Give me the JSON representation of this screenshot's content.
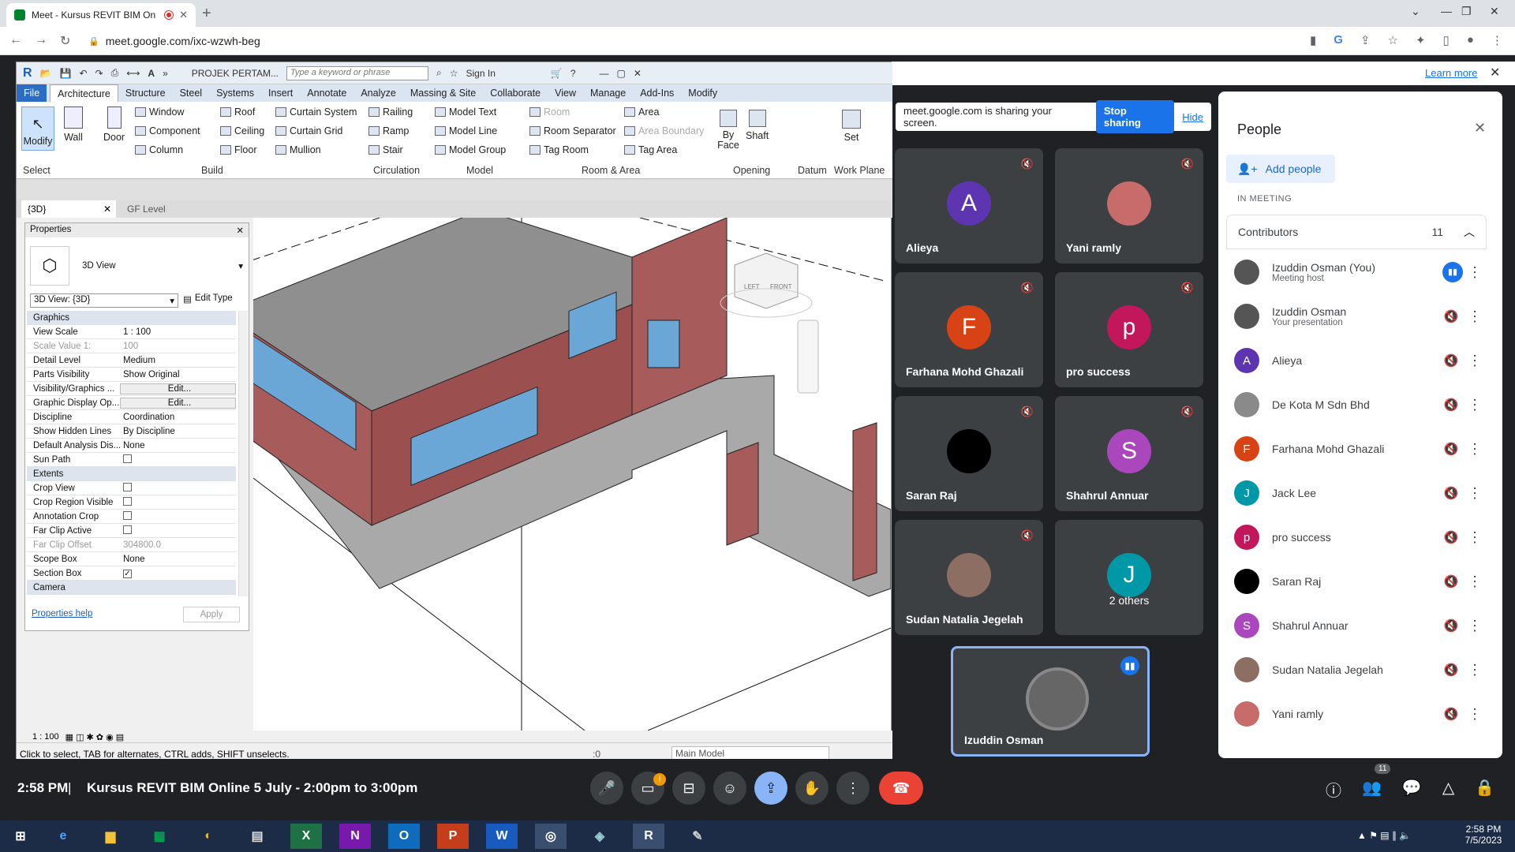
{
  "browser": {
    "tab_title": "Meet - Kursus REVIT BIM On",
    "url": "meet.google.com/ixc-wzwh-beg",
    "learn_more": "Learn more"
  },
  "revit": {
    "qat_project": "PROJEK PERTAM...",
    "search_placeholder": "Type a keyword or phrase",
    "sign_in": "Sign In",
    "tabs": [
      "File",
      "Architecture",
      "Structure",
      "Steel",
      "Systems",
      "Insert",
      "Annotate",
      "Analyze",
      "Massing & Site",
      "Collaborate",
      "View",
      "Manage",
      "Add-Ins",
      "Modify"
    ],
    "ribbon": {
      "modify": "Modify",
      "wall": "Wall",
      "door": "Door",
      "window": "Window",
      "component": "Component",
      "column": "Column",
      "roof": "Roof",
      "ceiling": "Ceiling",
      "floor": "Floor",
      "curtain_system": "Curtain System",
      "curtain_grid": "Curtain Grid",
      "mullion": "Mullion",
      "railing": "Railing",
      "ramp": "Ramp",
      "stair": "Stair",
      "model_text": "Model Text",
      "model_line": "Model Line",
      "model_group": "Model Group",
      "room": "Room",
      "room_separator": "Room Separator",
      "tag_room": "Tag Room",
      "area": "Area",
      "area_boundary": "Area Boundary",
      "tag_area": "Tag Area",
      "by_face": "By Face",
      "shaft": "Shaft",
      "set": "Set",
      "groups": {
        "select": "Select",
        "build": "Build",
        "circulation": "Circulation",
        "model": "Model",
        "room_area": "Room & Area",
        "opening": "Opening",
        "datum": "Datum",
        "work_plane": "Work Plane"
      }
    },
    "doc_tabs": [
      "{3D}",
      "GF Level"
    ],
    "properties": {
      "title": "Properties",
      "type": "3D View",
      "selector": "3D View: {3D}",
      "edit_type": "Edit Type",
      "rows": [
        {
          "k": "Graphics",
          "v": "",
          "sec": true
        },
        {
          "k": "View Scale",
          "v": "1 : 100"
        },
        {
          "k": "Scale Value    1:",
          "v": "100",
          "dim": true
        },
        {
          "k": "Detail Level",
          "v": "Medium"
        },
        {
          "k": "Parts Visibility",
          "v": "Show Original"
        },
        {
          "k": "Visibility/Graphics ...",
          "v": "Edit..."
        },
        {
          "k": "Graphic Display Op...",
          "v": "Edit..."
        },
        {
          "k": "Discipline",
          "v": "Coordination"
        },
        {
          "k": "Show Hidden Lines",
          "v": "By Discipline"
        },
        {
          "k": "Default Analysis Dis...",
          "v": "None"
        },
        {
          "k": "Sun Path",
          "v": ""
        },
        {
          "k": "Extents",
          "v": "",
          "sec": true
        },
        {
          "k": "Crop View",
          "v": ""
        },
        {
          "k": "Crop Region Visible",
          "v": ""
        },
        {
          "k": "Annotation Crop",
          "v": ""
        },
        {
          "k": "Far Clip Active",
          "v": ""
        },
        {
          "k": "Far Clip Offset",
          "v": "304800.0",
          "dim": true
        },
        {
          "k": "Scope Box",
          "v": "None"
        },
        {
          "k": "Section Box",
          "v": "✓"
        },
        {
          "k": "Camera",
          "v": "",
          "sec": true
        }
      ],
      "help": "Properties help",
      "apply": "Apply"
    },
    "viewcube": {
      "left": "LEFT",
      "front": "FRONT"
    },
    "status_scale": "1 : 100",
    "status_text": "Click to select, TAB for alternates, CTRL adds, SHIFT unselects.",
    "status_zero": ":0",
    "main_model": "Main Model"
  },
  "meet": {
    "sharing_text": "meet.google.com is sharing your screen.",
    "stop_sharing": "Stop sharing",
    "hide": "Hide",
    "time": "2:58 PM",
    "separator": "|",
    "meeting_title": "Kursus REVIT BIM Online 5 July - 2:00pm to 3:00pm",
    "tiles": [
      {
        "name": "Alieya",
        "initial": "A",
        "color": "#5e35b1"
      },
      {
        "name": "Yani ramly",
        "initial": "",
        "color": "#c76b6b"
      },
      {
        "name": "Farhana Mohd Ghazali",
        "initial": "F",
        "color": "#d84315"
      },
      {
        "name": "pro success",
        "initial": "p",
        "color": "#c2185b"
      },
      {
        "name": "Saran Raj",
        "initial": "",
        "color": "#000000"
      },
      {
        "name": "Shahrul Annuar",
        "initial": "S",
        "color": "#ab47bc"
      },
      {
        "name": "Sudan Natalia Jegelah",
        "initial": "",
        "color": "#8d6e63"
      },
      {
        "name": "2 others",
        "initial": "J",
        "color": "#0097a7"
      }
    ],
    "self_tile": "Izuddin Osman",
    "people": {
      "title": "People",
      "add": "Add people",
      "in_meeting": "IN MEETING",
      "contributors": "Contributors",
      "count": "11",
      "list": [
        {
          "name": "Izuddin Osman (You)",
          "sub": "Meeting host",
          "initial": "",
          "color": "#555555"
        },
        {
          "name": "Izuddin Osman",
          "sub": "Your presentation",
          "initial": "",
          "color": "#555555"
        },
        {
          "name": "Alieya",
          "sub": "",
          "initial": "A",
          "color": "#5e35b1"
        },
        {
          "name": "De Kota M Sdn Bhd",
          "sub": "",
          "initial": "",
          "color": "#8a8a8a"
        },
        {
          "name": "Farhana Mohd Ghazali",
          "sub": "",
          "initial": "F",
          "color": "#d84315"
        },
        {
          "name": "Jack Lee",
          "sub": "",
          "initial": "J",
          "color": "#0097a7"
        },
        {
          "name": "pro success",
          "sub": "",
          "initial": "p",
          "color": "#c2185b"
        },
        {
          "name": "Saran Raj",
          "sub": "",
          "initial": "",
          "color": "#000000"
        },
        {
          "name": "Shahrul Annuar",
          "sub": "",
          "initial": "S",
          "color": "#ab47bc"
        },
        {
          "name": "Sudan Natalia Jegelah",
          "sub": "",
          "initial": "",
          "color": "#8d6e63"
        },
        {
          "name": "Yani ramly",
          "sub": "",
          "initial": "",
          "color": "#c76b6b"
        }
      ]
    },
    "badge": "11"
  },
  "taskbar": {
    "time": "2:58 PM",
    "date": "7/5/2023"
  }
}
